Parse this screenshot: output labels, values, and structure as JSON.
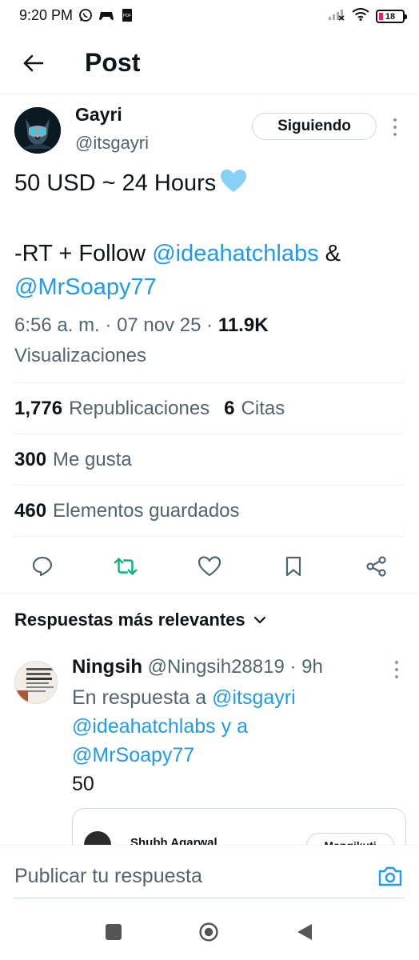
{
  "status_bar": {
    "time": "9:20 PM",
    "battery": "18",
    "icons": [
      "whatsapp-icon",
      "game-controller-icon",
      "pdf-icon",
      "signal-icon",
      "wifi-icon",
      "battery-icon"
    ]
  },
  "header": {
    "title": "Post",
    "back_icon": "arrow-left-icon"
  },
  "author": {
    "name": "Gayri",
    "handle": "@itsgayri",
    "follow_label": "Siguiendo"
  },
  "tweet": {
    "line1": "50 USD ~ 24 Hours",
    "emoji": "light-blue-heart",
    "line2_prefix": "-RT + Follow ",
    "mention1": "@ideahatchlabs",
    "line2_suffix": " &",
    "mention2": "@MrSoapy77"
  },
  "meta": {
    "time": "6:56 a. m.",
    "sep1": " · ",
    "date": "07 nov 25",
    "sep2": " · ",
    "views": "11.9K",
    "views_label": "Visualizaciones"
  },
  "stats": {
    "reposts_count": "1,776",
    "reposts_label": "Republicaciones",
    "quotes_count": "6",
    "quotes_label": "Citas",
    "likes_count": "300",
    "likes_label": "Me gusta",
    "bookmarks_count": "460",
    "bookmarks_label": "Elementos guardados"
  },
  "colors": {
    "link": "#1d9bf0",
    "retweet_active": "#00ba7c",
    "muted": "#536471"
  },
  "replies": {
    "sort_label": "Respuestas más relevantes",
    "items": [
      {
        "name": "Ningsih",
        "handle": "@Ningsih28819",
        "sep": " · ",
        "time": "9h",
        "reply_to_prefix": "En respuesta a ",
        "mention1": "@itsgayri",
        "mention2": "@ideahatchlabs",
        "conj": " y a",
        "mention3": "@MrSoapy77",
        "text": "50",
        "quote": {
          "name": "Shubh Agarwal",
          "follow_label": "Mengikuti"
        }
      }
    ]
  },
  "compose": {
    "placeholder": "Publicar tu respuesta"
  }
}
